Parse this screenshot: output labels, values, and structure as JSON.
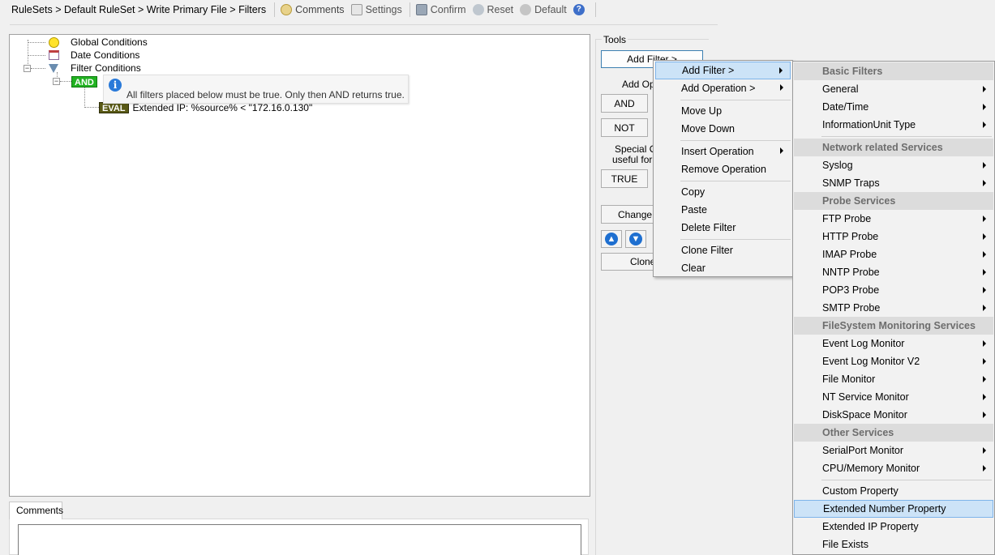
{
  "breadcrumb": "RuleSets > Default RuleSet > Write Primary File > Filters",
  "toolbar": {
    "comments": "Comments",
    "settings": "Settings",
    "confirm": "Confirm",
    "reset": "Reset",
    "default": "Default"
  },
  "tree": {
    "global_conditions": "Global Conditions",
    "date_conditions": "Date Conditions",
    "filter_conditions": "Filter Conditions",
    "and_badge": "AND",
    "eval_badge": "EVAL",
    "eval_text": "Extended IP: %source% < \"172.16.0.130\"",
    "tooltip": "All filters placed below must be true. Only then AND returns true."
  },
  "comments": {
    "tab": "Comments"
  },
  "tools": {
    "title": "Tools",
    "add_filter": "Add Filter >",
    "add_operation_label": "Add Ope",
    "and": "AND",
    "not": "NOT",
    "special_label_1": "Special O",
    "special_label_2": "useful for c",
    "true": "TRUE",
    "change": "Change C",
    "clone": "Clone"
  },
  "context_menu": {
    "items": [
      {
        "label": "Add Filter >",
        "submenu": true,
        "highlighted": true
      },
      {
        "label": "Add Operation >",
        "submenu": true
      },
      {
        "label": "Move Up"
      },
      {
        "label": "Move Down"
      },
      {
        "label": "Insert Operation",
        "submenu": true
      },
      {
        "label": "Remove Operation"
      },
      {
        "label": "Copy"
      },
      {
        "label": "Paste"
      },
      {
        "label": "Delete Filter"
      },
      {
        "label": "Clone Filter"
      },
      {
        "label": "Clear"
      }
    ]
  },
  "submenu": {
    "headers": {
      "basic": "Basic Filters",
      "network": "Network related Services",
      "probe": "Probe Services",
      "filesystem": "FileSystem Monitoring Services",
      "other": "Other Services"
    },
    "items": {
      "general": "General",
      "datetime": "Date/Time",
      "informationunit": "InformationUnit Type",
      "syslog": "Syslog",
      "snmp": "SNMP Traps",
      "ftp": "FTP Probe",
      "http": "HTTP Probe",
      "imap": "IMAP Probe",
      "nntp": "NNTP Probe",
      "pop3": "POP3 Probe",
      "smtp": "SMTP Probe",
      "eventlog": "Event Log Monitor",
      "eventlog2": "Event Log Monitor V2",
      "filemonitor": "File Monitor",
      "ntservice": "NT Service Monitor",
      "diskspace": "DiskSpace Monitor",
      "serialport": "SerialPort Monitor",
      "cpumem": "CPU/Memory Monitor",
      "custom": "Custom Property",
      "extnumber": "Extended Number Property",
      "extip": "Extended IP Property",
      "fileexists": "File Exists"
    }
  }
}
